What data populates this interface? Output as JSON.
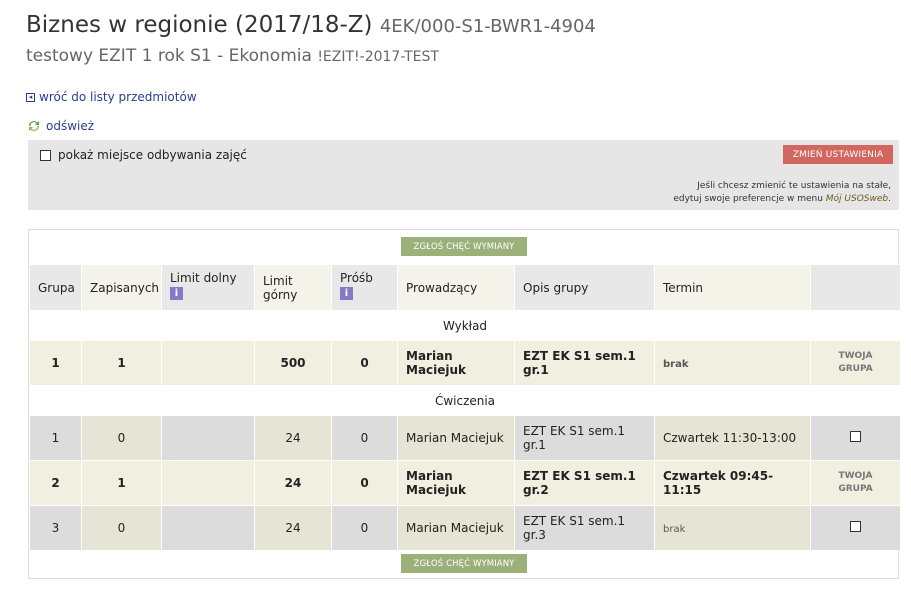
{
  "header": {
    "title": "Biznes w regionie (2017/18-Z)",
    "course_code": "4EK/000-S1-BWR1-4904",
    "program": "testowy EZIT 1 rok S1 - Ekonomia",
    "program_code": "!EZIT!-2017-TEST"
  },
  "nav": {
    "back_label": "wróć do listy przedmiotów",
    "refresh_label": "odśwież"
  },
  "settings": {
    "show_place_label": "pokaż miejsce odbywania zajęć",
    "show_place_checked": false,
    "change_button": "ZMIEŃ USTAWIENIA",
    "note_line1": "Jeśli chcesz zmienić te ustawienia na stałe,",
    "note_line2_prefix": "edytuj swoje preferencje w menu ",
    "note_link": "Mój USOSweb",
    "note_suffix": "."
  },
  "exchange_button": "ZGŁOŚ CHĘĆ WYMIANY",
  "table": {
    "headers": {
      "group": "Grupa",
      "enrolled": "Zapisanych",
      "min_limit": "Limit dolny",
      "max_limit_1": "Limit",
      "max_limit_2": "górny",
      "requests": "Próśb",
      "teacher": "Prowadzący",
      "desc": "Opis grupy",
      "term": "Termin"
    },
    "info_glyph": "i",
    "sections": [
      {
        "name": "Wykład",
        "rows": [
          {
            "group": "1",
            "enrolled": "1",
            "min": "",
            "max": "500",
            "req": "0",
            "teacher": "Marian Maciejuk",
            "desc": "EZT EK S1 sem.1 gr.1",
            "term": "brak",
            "action": "TWOJA GRUPA"
          }
        ]
      },
      {
        "name": "Ćwiczenia",
        "rows": [
          {
            "group": "1",
            "enrolled": "0",
            "min": "",
            "max": "24",
            "req": "0",
            "teacher": "Marian Maciejuk",
            "desc": "EZT EK S1 sem.1 gr.1",
            "term": "Czwartek 11:30-13:00",
            "action": "checkbox"
          },
          {
            "group": "2",
            "enrolled": "1",
            "min": "",
            "max": "24",
            "req": "0",
            "teacher": "Marian Maciejuk",
            "desc": "EZT EK S1 sem.1 gr.2",
            "term": "Czwartek 09:45-11:15",
            "action": "TWOJA GRUPA"
          },
          {
            "group": "3",
            "enrolled": "0",
            "min": "",
            "max": "24",
            "req": "0",
            "teacher": "Marian Maciejuk",
            "desc": "EZT EK S1 sem.1 gr.3",
            "term": "brak",
            "action": "checkbox"
          }
        ]
      }
    ]
  },
  "your_group_line1": "TWOJA",
  "your_group_line2": "GRUPA",
  "icons": {
    "back": "back-arrow-icon",
    "refresh": "refresh-icon",
    "info": "info-icon"
  },
  "colors": {
    "change_button": "#d1675f",
    "exchange_button": "#9cb07a",
    "link": "#2a3e92",
    "info_icon": "#8878c8"
  }
}
